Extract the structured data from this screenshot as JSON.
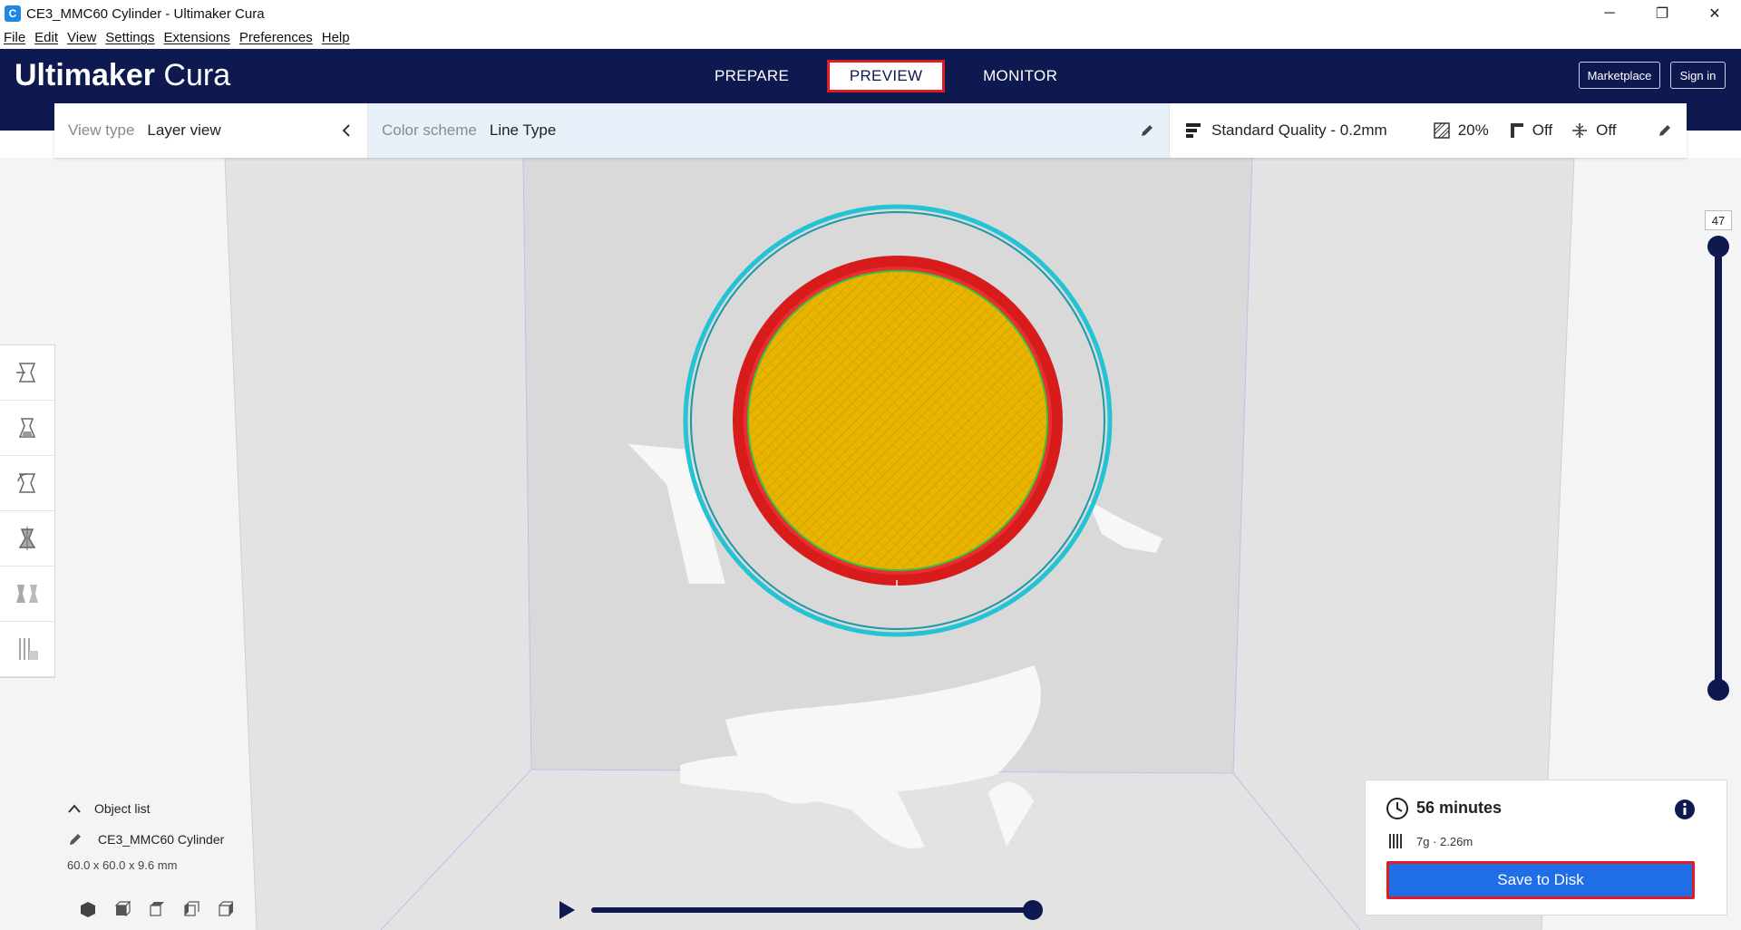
{
  "window": {
    "title": "CE3_MMC60 Cylinder - Ultimaker Cura",
    "app_icon": "C",
    "controls": {
      "minimize": "─",
      "maximize": "❐",
      "close": "✕"
    }
  },
  "menu": [
    "File",
    "Edit",
    "View",
    "Settings",
    "Extensions",
    "Preferences",
    "Help"
  ],
  "header": {
    "logo_bold": "Ultimaker",
    "logo_light": "Cura",
    "tabs": [
      {
        "label": "PREPARE"
      },
      {
        "label": "PREVIEW",
        "active": true
      },
      {
        "label": "MONITOR"
      }
    ],
    "marketplace_label": "Marketplace",
    "signin_label": "Sign in"
  },
  "toolbar": {
    "view_type_label": "View type",
    "view_type_value": "Layer view",
    "color_scheme_label": "Color scheme",
    "color_scheme_value": "Line Type",
    "quality": "Standard Quality - 0.2mm",
    "infill": "20%",
    "support": "Off",
    "adhesion": "Off"
  },
  "layer_slider": {
    "value": "47"
  },
  "object_list": {
    "header": "Object list",
    "object_name": "CE3_MMC60 Cylinder",
    "dimensions": "60.0 x 60.0 x 9.6 mm"
  },
  "print_info": {
    "time": "56 minutes",
    "material": "7g · 2.26m",
    "save_label": "Save to Disk"
  },
  "colors": {
    "brand_dark": "#0e1a4f",
    "accent_blue": "#1e6ee8",
    "highlight_red": "#e01b24",
    "infill_yellow": "#e6b800",
    "wall_red": "#e02020",
    "skirt_cyan": "#22c3d4"
  }
}
